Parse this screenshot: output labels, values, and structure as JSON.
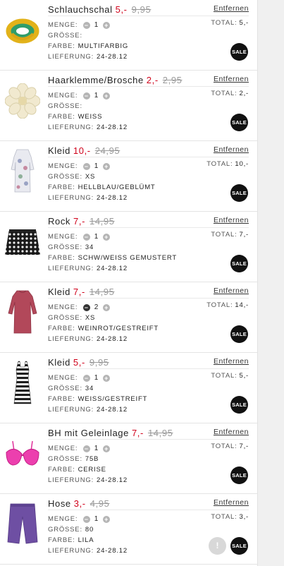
{
  "labels": {
    "menge": "MENGE:",
    "groesse": "GRÖSSE:",
    "farbe": "FARBE:",
    "lieferung": "LIEFERUNG:",
    "total": "TOTAL:",
    "remove": "Entfernen",
    "sale": "SALE",
    "minus": "−",
    "plus": "+"
  },
  "items": [
    {
      "name": "Schlauchschal",
      "price": "5,-",
      "old_price": "9,95",
      "qty": "1",
      "size": "",
      "color": "MULTIFARBIG",
      "delivery": "24-28.12",
      "total": "5,-",
      "thumb": "scarf"
    },
    {
      "name": "Haarklemme/Brosche",
      "price": "2,-",
      "old_price": "2,95",
      "qty": "1",
      "size": "",
      "color": "WEISS",
      "delivery": "24-28.12",
      "total": "2,-",
      "thumb": "flower-brooch"
    },
    {
      "name": "Kleid",
      "price": "10,-",
      "old_price": "24,95",
      "qty": "1",
      "size": "XS",
      "color": "HELLBLAU/GEBLÜMT",
      "delivery": "24-28.12",
      "total": "10,-",
      "thumb": "floral-dress"
    },
    {
      "name": "Rock",
      "price": "7,-",
      "old_price": "14,95",
      "qty": "1",
      "size": "34",
      "color": "SCHW/WEISS GEMUSTERT",
      "delivery": "24-28.12",
      "total": "7,-",
      "thumb": "patterned-skirt"
    },
    {
      "name": "Kleid",
      "price": "7,-",
      "old_price": "14,95",
      "qty": "2",
      "size": "XS",
      "color": "WEINROT/GESTREIFT",
      "delivery": "24-28.12",
      "total": "14,-",
      "thumb": "red-dress"
    },
    {
      "name": "Kleid",
      "price": "5,-",
      "old_price": "9,95",
      "qty": "1",
      "size": "34",
      "color": "WEISS/GESTREIFT",
      "delivery": "24-28.12",
      "total": "5,-",
      "thumb": "striped-dress"
    },
    {
      "name": "BH mit Geleinlage",
      "price": "7,-",
      "old_price": "14,95",
      "qty": "1",
      "size": "75B",
      "color": "CERISE",
      "delivery": "24-28.12",
      "total": "7,-",
      "thumb": "pink-bra"
    },
    {
      "name": "Hose",
      "price": "3,-",
      "old_price": "4,95",
      "qty": "1",
      "size": "80",
      "color": "LILA",
      "delivery": "24-28.12",
      "total": "3,-",
      "thumb": "purple-pants",
      "warning": "!"
    }
  ],
  "colors": {
    "sale_red": "#d0021b",
    "badge_black": "#111111"
  }
}
